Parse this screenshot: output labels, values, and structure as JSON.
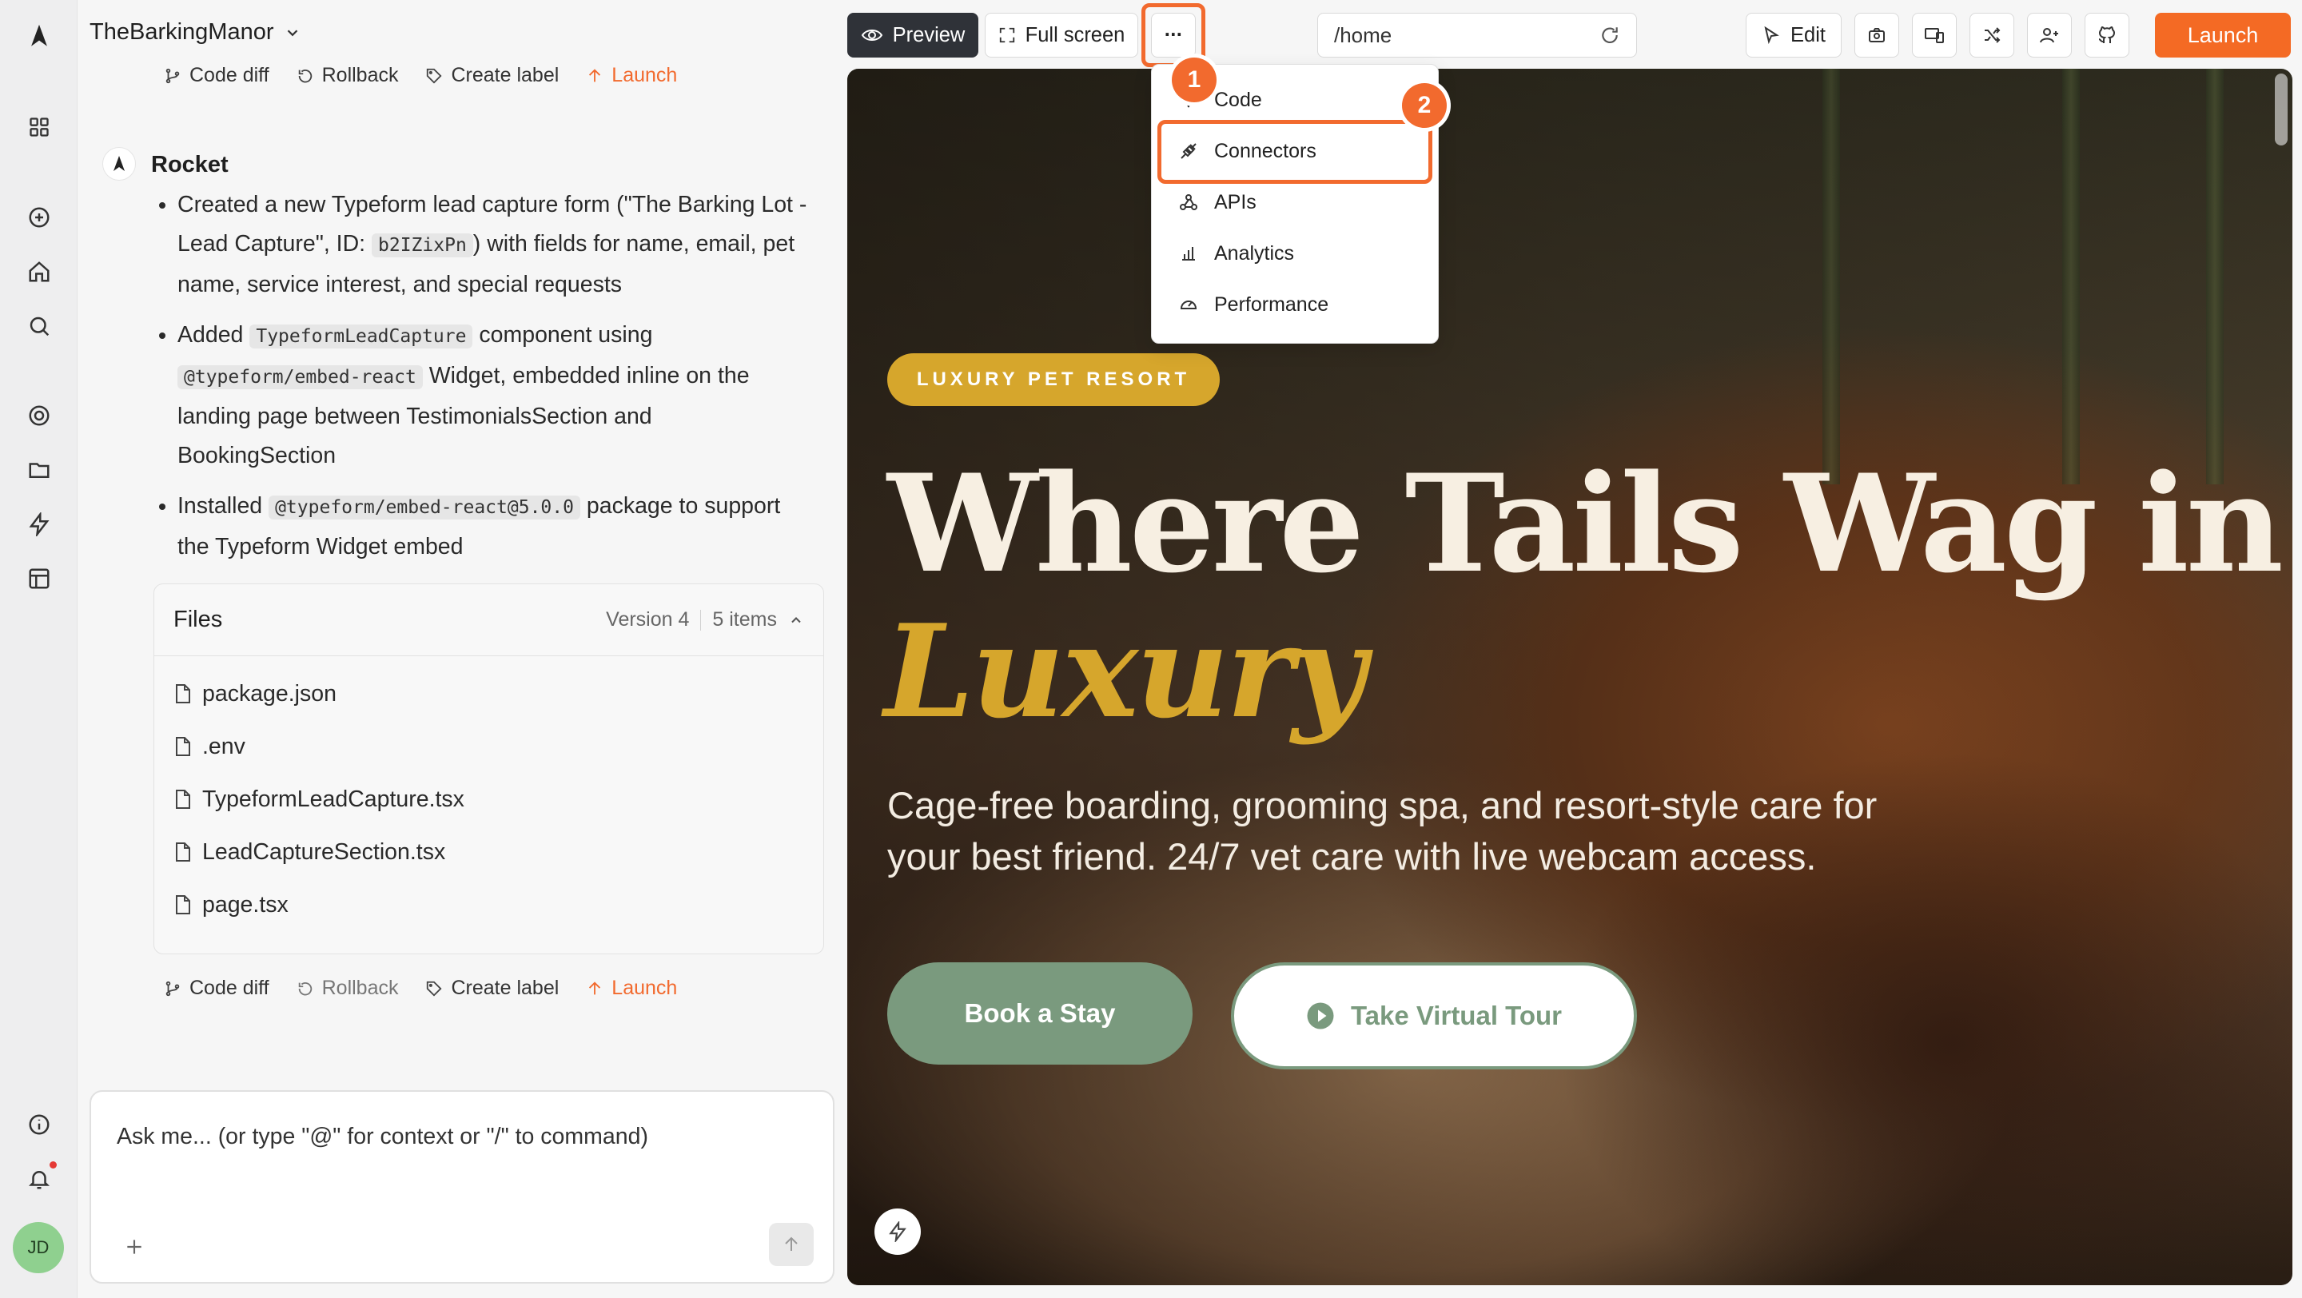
{
  "project": {
    "name": "TheBarkingManor"
  },
  "top_actions": {
    "code_diff": "Code diff",
    "rollback": "Rollback",
    "create_label": "Create label",
    "launch": "Launch"
  },
  "message": {
    "author": "Rocket",
    "bullets": [
      {
        "parts": [
          "Created a new Typeform lead capture form (\"The Barking Lot - Lead Capture\", ID: ",
          "b2IZixPn",
          ") with fields for name, email, pet name, service interest, and special requests"
        ]
      },
      {
        "parts": [
          "Added ",
          "TypeformLeadCapture",
          " component using ",
          "@typeform/embed-react",
          " Widget, embedded inline on the landing page between TestimonialsSection and BookingSection"
        ]
      },
      {
        "parts": [
          "Installed ",
          "@typeform/embed-react@5.0.0",
          " package to support the Typeform Widget embed"
        ]
      }
    ]
  },
  "files": {
    "title": "Files",
    "version": "Version 4",
    "count": "5 items",
    "items": [
      "package.json",
      ".env",
      "TypeformLeadCapture.tsx",
      "LeadCaptureSection.tsx",
      "page.tsx"
    ]
  },
  "bottom_actions": {
    "code_diff": "Code diff",
    "rollback": "Rollback",
    "create_label": "Create label",
    "launch": "Launch"
  },
  "chat_input": {
    "placeholder": "Ask me... (or type \"@\" for context or \"/\" to command)"
  },
  "user": {
    "initials": "JD"
  },
  "toolbar": {
    "preview": "Preview",
    "full_screen": "Full screen",
    "more": "···",
    "url": "/home",
    "edit": "Edit",
    "launch": "Launch"
  },
  "dropdown": {
    "items": [
      "Code",
      "Connectors",
      "APIs",
      "Analytics",
      "Performance"
    ]
  },
  "annotations": {
    "marker1": "1",
    "marker2": "2"
  },
  "site": {
    "badge": "LUXURY PET RESORT",
    "headline_1": "Where Tails Wag in",
    "headline_2": "Luxury",
    "subtitle": "Cage-free boarding, grooming spa, and resort-style care for your best friend. 24/7 vet care with live webcam access.",
    "primary_cta": "Book a Stay",
    "secondary_cta": "Take Virtual Tour"
  },
  "colors": {
    "accent": "#f46a24",
    "gold": "#d6a62c",
    "sage": "#7a9a7e",
    "preview_button": "#2f3238"
  }
}
